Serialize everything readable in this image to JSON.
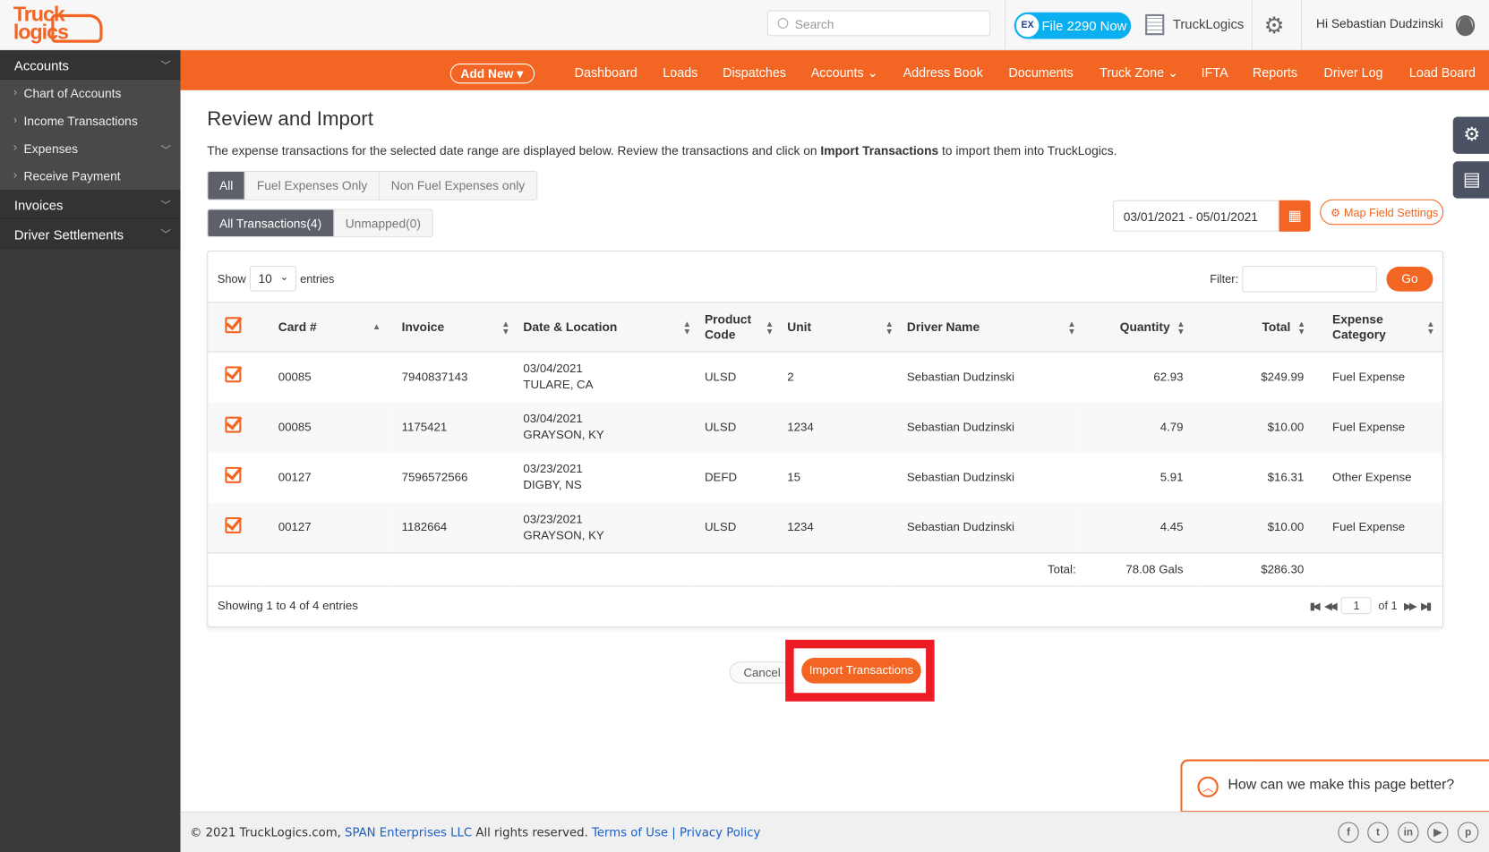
{
  "header": {
    "logo_text": "TruckLogics",
    "search_placeholder": "Search",
    "file2290_label": "File 2290 Now",
    "file2290_badge": "EX",
    "company": "TruckLogics",
    "greeting": "Hi Sebastian Dudzinski"
  },
  "sidebar": {
    "sections": [
      {
        "label": "Accounts",
        "items": [
          "Chart of Accounts",
          "Income Transactions",
          "Expenses",
          "Receive Payment"
        ]
      },
      {
        "label": "Invoices"
      },
      {
        "label": "Driver Settlements"
      }
    ]
  },
  "nav": {
    "add_new": "Add New",
    "items": [
      "Dashboard",
      "Loads",
      "Dispatches",
      "Accounts",
      "Address Book",
      "Documents",
      "Truck Zone",
      "IFTA",
      "Reports",
      "Driver Log",
      "Load Board"
    ]
  },
  "page": {
    "title": "Review and Import",
    "desc_pre": "The expense transactions for the selected date range are displayed below. Review the transactions and click on ",
    "desc_bold": "Import Transactions",
    "desc_post": " to import them into TruckLogics.",
    "type_filters": [
      "All",
      "Fuel Expenses Only",
      "Non Fuel Expenses only"
    ],
    "type_selected": "All",
    "status_filters": [
      "All Transactions(4)",
      "Unmapped(0)"
    ],
    "status_selected": "All Transactions(4)",
    "date_range": "03/01/2021 - 05/01/2021",
    "map_field_settings": "Map Field Settings"
  },
  "table": {
    "show_label": "Show",
    "page_length": "10",
    "entries_label": "entries",
    "filter_label": "Filter:",
    "filter_value": "",
    "go_label": "Go",
    "columns": [
      "Card #",
      "Invoice",
      "Date & Location",
      "Product Code",
      "Unit",
      "Driver Name",
      "Quantity",
      "Total",
      "Expense Category"
    ],
    "rows": [
      {
        "checked": true,
        "card": "00085",
        "invoice": "7940837143",
        "date": "03/04/2021",
        "location": "TULARE, CA",
        "product": "ULSD",
        "unit": "2",
        "driver": "Sebastian Dudzinski",
        "quantity": "62.93",
        "total": "$249.99",
        "category": "Fuel Expense"
      },
      {
        "checked": true,
        "card": "00085",
        "invoice": "1175421",
        "date": "03/04/2021",
        "location": "GRAYSON, KY",
        "product": "ULSD",
        "unit": "1234",
        "driver": "Sebastian Dudzinski",
        "quantity": "4.79",
        "total": "$10.00",
        "category": "Fuel Expense"
      },
      {
        "checked": true,
        "card": "00127",
        "invoice": "7596572566",
        "date": "03/23/2021",
        "location": "DIGBY, NS",
        "product": "DEFD",
        "unit": "15",
        "driver": "Sebastian Dudzinski",
        "quantity": "5.91",
        "total": "$16.31",
        "category": "Other Expense"
      },
      {
        "checked": true,
        "card": "00127",
        "invoice": "1182664",
        "date": "03/23/2021",
        "location": "GRAYSON, KY",
        "product": "ULSD",
        "unit": "1234",
        "driver": "Sebastian Dudzinski",
        "quantity": "4.45",
        "total": "$10.00",
        "category": "Fuel Expense"
      }
    ],
    "footer": {
      "label": "Total:",
      "quantity": "78.08 Gals",
      "total": "$286.30"
    },
    "info": "Showing 1 to 4 of 4 entries",
    "current_page": "1",
    "of_pages": "of 1"
  },
  "actions": {
    "cancel": "Cancel",
    "import": "Import Transactions"
  },
  "feedback": "How can we make this page better?",
  "footer": {
    "copyright": "© 2021 TruckLogics.com,",
    "company_link": "SPAN Enterprises LLC",
    "rights": "All rights reserved.",
    "terms": "Terms of Use",
    "sep": "|",
    "privacy": "Privacy Policy",
    "social": [
      "f",
      "t",
      "in",
      "yt",
      "p"
    ]
  },
  "colors": {
    "brand": "#f26522",
    "sidebar": "#3a3a3a",
    "file2290": "#0aaff0",
    "highlight": "#ed1c24"
  }
}
